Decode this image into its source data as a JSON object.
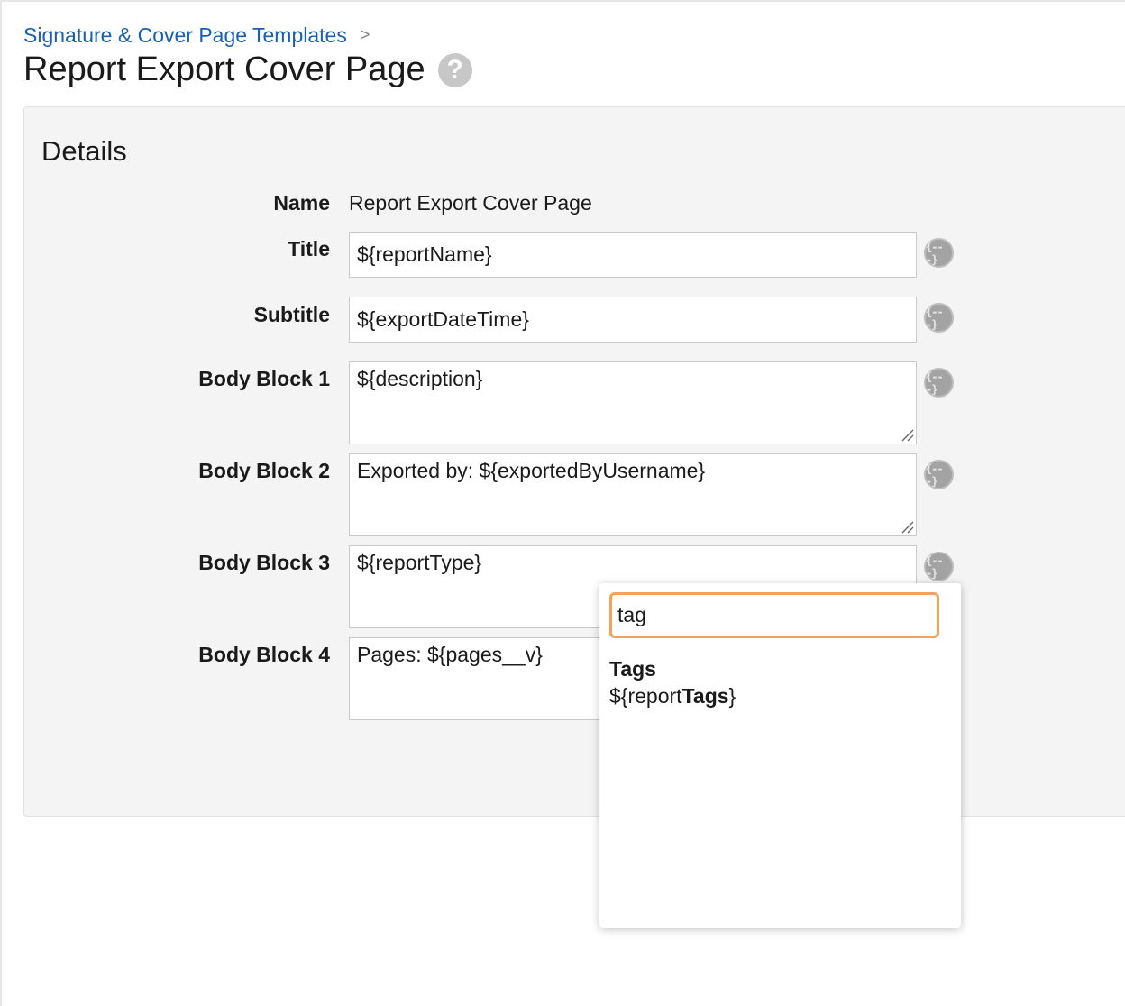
{
  "breadcrumb": {
    "link": "Signature & Cover Page Templates",
    "separator": ">"
  },
  "page": {
    "title": "Report Export Cover Page",
    "help_icon": "question-mark-circle-icon"
  },
  "details": {
    "title": "Details",
    "name": {
      "label": "Name",
      "value": "Report Export Cover Page"
    },
    "title_field": {
      "label": "Title",
      "value": "${reportName}"
    },
    "subtitle_field": {
      "label": "Subtitle",
      "value": "${exportDateTime}"
    },
    "body_block_1": {
      "label": "Body Block 1",
      "value": "${description}"
    },
    "body_block_2": {
      "label": "Body Block 2",
      "value": "Exported by: ${exportedByUsername}"
    },
    "body_block_3": {
      "label": "Body Block 3",
      "value": "${reportType}"
    },
    "body_block_4": {
      "label": "Body Block 4",
      "value": "Pages: ${pages__v}"
    },
    "token_button_glyph": "{---}"
  },
  "token_popup": {
    "search_value": "tag",
    "group_label": "Tags",
    "result": {
      "prefix": "${report",
      "match": "Tags",
      "suffix": "}"
    }
  },
  "colors": {
    "link": "#1a5fb4",
    "focus_border": "#f0a25e",
    "panel_background": "#f4f4f4",
    "token_button": "#a3a3a3"
  }
}
